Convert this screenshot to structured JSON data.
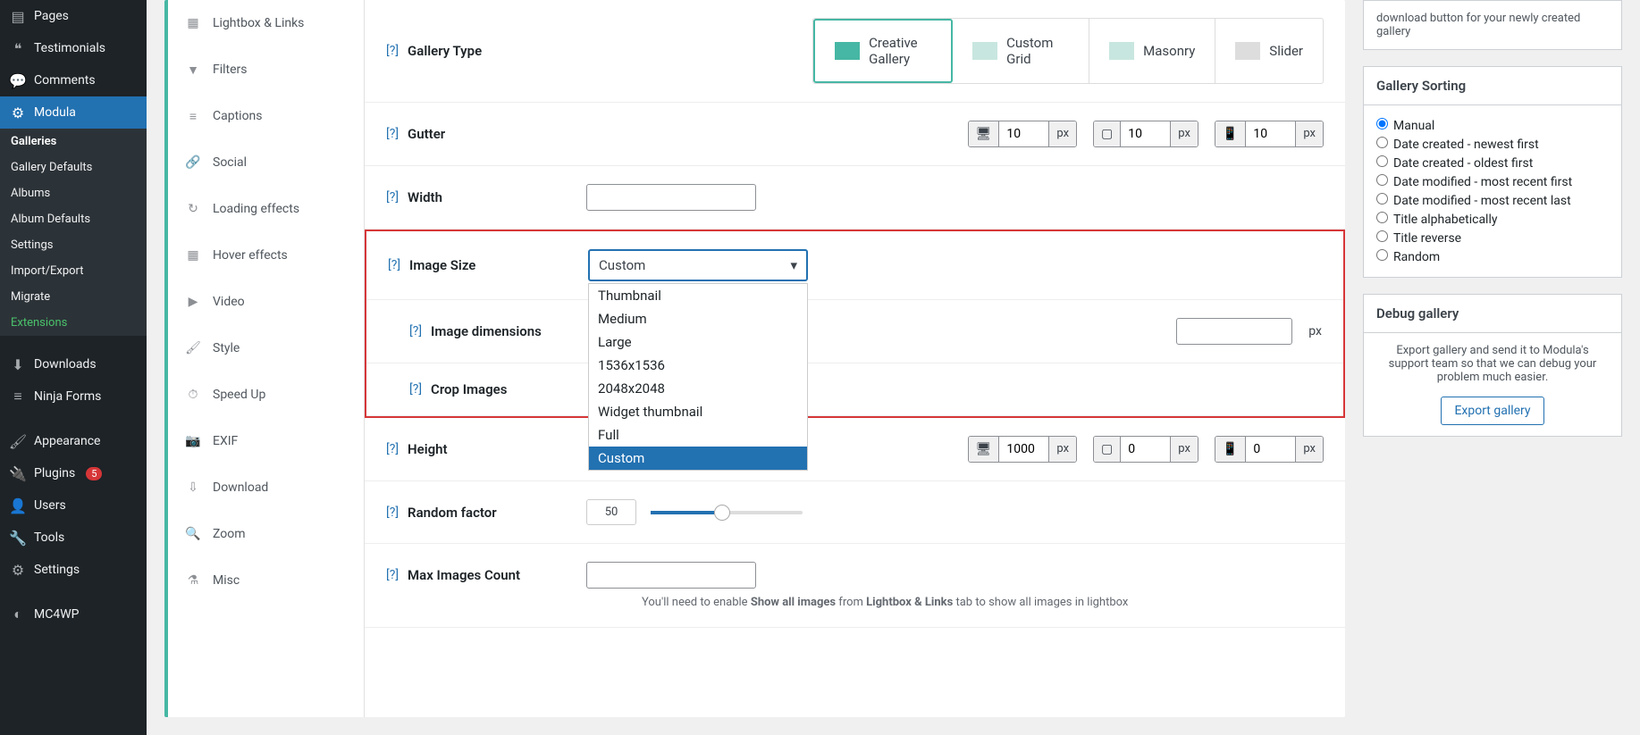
{
  "sidebar": {
    "items": [
      {
        "label": "Pages",
        "ic": "▤"
      },
      {
        "label": "Testimonials",
        "ic": "❝"
      },
      {
        "label": "Comments",
        "ic": "💬"
      },
      {
        "label": "Modula",
        "ic": "⚙",
        "active": true
      },
      {
        "label": "Downloads",
        "ic": "⬇"
      },
      {
        "label": "Ninja Forms",
        "ic": "≡"
      },
      {
        "label": "Appearance",
        "ic": "🖌"
      },
      {
        "label": "Plugins",
        "ic": "🔌",
        "badge": "5"
      },
      {
        "label": "Users",
        "ic": "👤"
      },
      {
        "label": "Tools",
        "ic": "🔧"
      },
      {
        "label": "Settings",
        "ic": "⚙"
      },
      {
        "label": "MC4WP",
        "ic": "◐"
      }
    ],
    "subs": [
      {
        "label": "Galleries",
        "current": true
      },
      {
        "label": "Gallery Defaults"
      },
      {
        "label": "Albums"
      },
      {
        "label": "Album Defaults"
      },
      {
        "label": "Settings"
      },
      {
        "label": "Import/Export"
      },
      {
        "label": "Migrate"
      },
      {
        "label": "Extensions",
        "ext": true
      }
    ]
  },
  "tabs": [
    {
      "label": "Lightbox & Links",
      "ic": "▦"
    },
    {
      "label": "Filters",
      "ic": "▼"
    },
    {
      "label": "Captions",
      "ic": "≡"
    },
    {
      "label": "Social",
      "ic": "🔗"
    },
    {
      "label": "Loading effects",
      "ic": "↻"
    },
    {
      "label": "Hover effects",
      "ic": "▦"
    },
    {
      "label": "Video",
      "ic": "▶"
    },
    {
      "label": "Style",
      "ic": "🖌"
    },
    {
      "label": "Speed Up",
      "ic": "⏱"
    },
    {
      "label": "EXIF",
      "ic": "📷"
    },
    {
      "label": "Download",
      "ic": "⇩"
    },
    {
      "label": "Zoom",
      "ic": "🔍"
    },
    {
      "label": "Misc",
      "ic": "⚗"
    }
  ],
  "settings": {
    "gallery_type": {
      "label": "Gallery Type",
      "options": [
        "Creative Gallery",
        "Custom Grid",
        "Masonry",
        "Slider"
      ],
      "selected": "Creative Gallery"
    },
    "gutter": {
      "label": "Gutter",
      "desktop": "10",
      "tablet": "10",
      "mobile": "10",
      "unit": "px"
    },
    "width": {
      "label": "Width",
      "value": ""
    },
    "image_size": {
      "label": "Image Size",
      "value": "Custom",
      "options": [
        "Thumbnail",
        "Medium",
        "Large",
        "1536x1536",
        "2048x2048",
        "Widget thumbnail",
        "Full",
        "Custom"
      ]
    },
    "image_dimensions": {
      "label": "Image dimensions",
      "unit": "px"
    },
    "crop": {
      "label": "Crop Images"
    },
    "height": {
      "label": "Height",
      "desktop": "1000",
      "tablet": "0",
      "mobile": "0",
      "unit": "px"
    },
    "random": {
      "label": "Random factor",
      "value": "50"
    },
    "max_images": {
      "label": "Max Images Count",
      "value": "",
      "hint_pre": "You'll need to enable ",
      "hint_b1": "Show all images",
      "hint_mid": " from ",
      "hint_b2": "Lightbox & Links",
      "hint_post": " tab to show all images in lightbox"
    }
  },
  "right": {
    "shortcode_hint": "download button for your newly created gallery",
    "sorting": {
      "title": "Gallery Sorting",
      "options": [
        "Manual",
        "Date created - newest first",
        "Date created - oldest first",
        "Date modified - most recent first",
        "Date modified - most recent last",
        "Title alphabetically",
        "Title reverse",
        "Random"
      ],
      "selected": "Manual"
    },
    "debug": {
      "title": "Debug gallery",
      "text": "Export gallery and send it to Modula's support team so that we can debug your problem much easier.",
      "btn": "Export gallery"
    }
  }
}
